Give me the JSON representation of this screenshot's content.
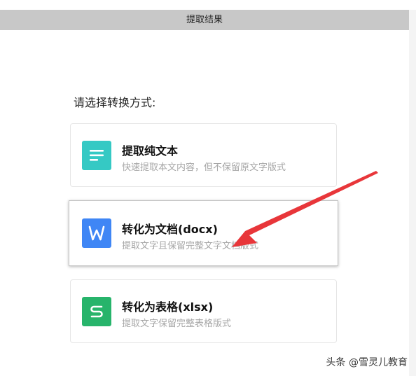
{
  "dialog": {
    "title": "提取结果",
    "prompt": "请选择转换方式:",
    "options": [
      {
        "title": "提取纯文本",
        "desc": "快速提取本文内容，但不保留原文字版式",
        "icon": "text-lines-icon",
        "color": "#35c9c4",
        "selected": false
      },
      {
        "title": "转化为文档(docx)",
        "desc": "提取文字且保留完整文字文档版式",
        "icon": "word-w-icon",
        "color": "#3f86f5",
        "selected": true
      },
      {
        "title": "转化为表格(xlsx)",
        "desc": "提取文字保留完整表格版式",
        "icon": "sheet-s-icon",
        "color": "#27b46b",
        "selected": false
      }
    ]
  },
  "annotation": {
    "arrow_color": "#e8363a",
    "icon": "red-arrow-icon"
  },
  "watermark": {
    "text": "头条 @雪灵儿教育"
  }
}
